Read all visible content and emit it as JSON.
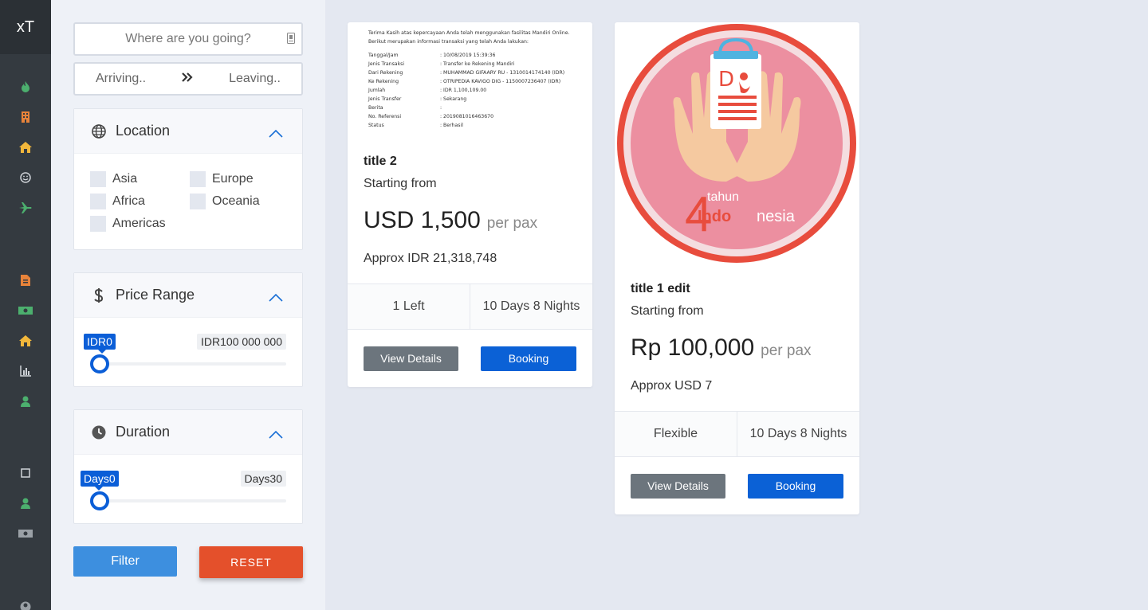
{
  "rail": {
    "brand": "xT",
    "icons": [
      "fire-icon",
      "building-icon",
      "home-icon",
      "smile-icon",
      "plane-icon",
      "file-invoice-icon",
      "money-bill-icon",
      "home-icon",
      "chart-bar-icon",
      "user-icon",
      "square-icon",
      "user-icon",
      "money-icon",
      "user-circle-icon"
    ]
  },
  "search": {
    "placeholder": "Where are you going?"
  },
  "dates": {
    "arriving": "Arriving..",
    "leaving": "Leaving.."
  },
  "location": {
    "title": "Location",
    "regions": [
      "Asia",
      "Europe",
      "Africa",
      "Oceania",
      "Americas"
    ]
  },
  "price_range": {
    "title": "Price Range",
    "min_label": "IDR0",
    "max_label": "IDR100 000 000",
    "value_fraction": 0
  },
  "duration": {
    "title": "Duration",
    "min_label": "Days0",
    "max_label": "Days30",
    "value_fraction": 0
  },
  "buttons": {
    "filter": "Filter",
    "reset": "RESET"
  },
  "receipt": {
    "intro1": "Terima Kasih atas kepercayaan Anda telah menggunakan fasilitas Mandiri Online.",
    "intro2": "Berikut merupakan informasi transaksi yang telah Anda lakukan:",
    "rows": [
      {
        "k": "Tanggal/Jam",
        "v": ": 10/08/2019 15:39:36"
      },
      {
        "k": "Jenis Transaksi",
        "v": ": Transfer ke Rekening Mandiri"
      },
      {
        "k": "Dari Rekening",
        "v": ": MUHAMMAD GIFAARY RU - 1310014174140 (IDR)"
      },
      {
        "k": "Ke Rekening",
        "v": ": OTRIPEDIA KAVIGO DIG - 1150007236407 (IDR)"
      },
      {
        "k": "Jumlah",
        "v": ": IDR 1,100,109.00"
      },
      {
        "k": "Jenis Transfer",
        "v": ": Sekarang"
      },
      {
        "k": "Berita",
        "v": ":"
      },
      {
        "k": "No. Referensi",
        "v": ": 2019081016463670"
      },
      {
        "k": "Status",
        "v": ": Berhasil"
      }
    ]
  },
  "packages": [
    {
      "title": "title 2",
      "starting": "Starting from",
      "amount": "USD 1,500",
      "per": "per pax",
      "approx": "Approx IDR 21,318,748",
      "availability": "1 Left",
      "duration": "10 Days 8 Nights",
      "view": "View Details",
      "book": "Booking"
    },
    {
      "title": "title 1 edit",
      "starting": "Starting from",
      "amount": "Rp 100,000",
      "per": "per pax",
      "approx": "Approx USD 7",
      "availability": "Flexible",
      "duration": "10 Days 8 Nights",
      "view": "View Details",
      "book": "Booking",
      "logo": {
        "number": "4",
        "word1": "tahun",
        "word2a": "Indo",
        "word2b": "nesia",
        "letter": "D"
      }
    }
  ],
  "colors": {
    "accent": "#0b5ed7",
    "reset": "#e4502b",
    "rail": "#343a40",
    "green": "#4caf6e",
    "orange": "#e8833a"
  }
}
